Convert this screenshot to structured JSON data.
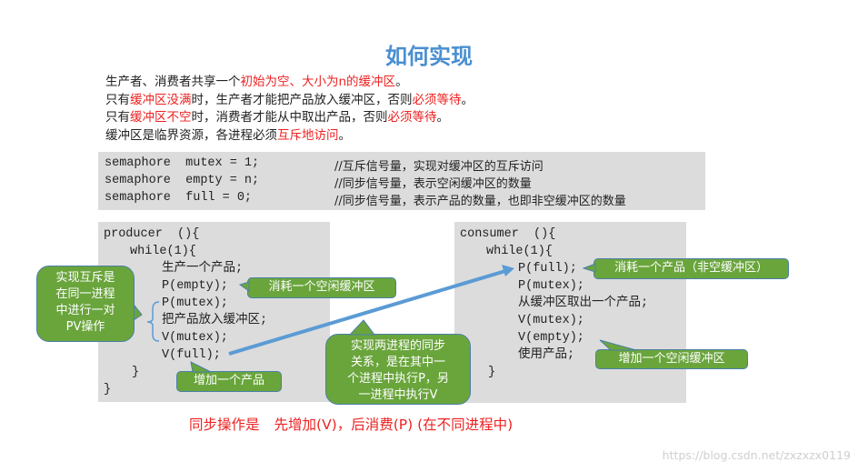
{
  "title": "如何实现",
  "intro": {
    "line1": {
      "a": "生产者、消费者共享一个",
      "b": "初始为空、大小为n的缓冲区",
      "c": "。"
    },
    "line2": {
      "a": "只有",
      "b": "缓冲区没满",
      "c": "时，生产者才能把产品放入缓冲区，否则",
      "d": "必须等待",
      "e": "。"
    },
    "line3": {
      "a": "只有",
      "b": "缓冲区不空",
      "c": "时，消费者才能从中取出产品，否则",
      "d": "必须等待",
      "e": "。"
    },
    "line4": {
      "a": "缓冲区是临界资源，各进程必须",
      "b": "互斥地访问",
      "c": "。"
    }
  },
  "semaphores": [
    {
      "decl": "semaphore  mutex = 1;",
      "comment": "//互斥信号量，实现对缓冲区的互斥访问"
    },
    {
      "decl": "semaphore  empty = n;",
      "comment": "//同步信号量，表示空闲缓冲区的数量"
    },
    {
      "decl": "semaphore  full = 0;",
      "comment": "//同步信号量，表示产品的数量，也即非空缓冲区的数量"
    }
  ],
  "producer": {
    "header": "producer  (){",
    "loop": "while(1){",
    "lines": [
      "生产一个产品;",
      "P(empty);",
      "P(mutex);",
      "把产品放入缓冲区;",
      "V(mutex);",
      "V(full);"
    ],
    "close_loop": "}",
    "close_fn": "}"
  },
  "consumer": {
    "header": "consumer  (){",
    "loop": "while(1){",
    "lines": [
      "P(full);",
      "P(mutex);",
      "从缓冲区取出一个产品;",
      "V(mutex);",
      "V(empty);",
      "使用产品;"
    ],
    "close_loop": "}"
  },
  "callouts": {
    "mutex_pair": "实现互斥是在同一进程中进行一对PV操作",
    "mutex_pair_lines": [
      "实现互斥是",
      "在同一进程",
      "中进行一对",
      "PV操作"
    ],
    "consume_empty": "消耗一个空闲缓冲区",
    "add_product": "增加一个产品",
    "sync_lines": [
      "实现两进程的同步",
      "关系，是在其中一",
      "个进程中执行P，另",
      "一进程中执行V"
    ],
    "consume_product": "消耗一个产品（非空缓冲区）",
    "add_empty": "增加一个空闲缓冲区"
  },
  "footer": {
    "a": "同步操作是",
    "b": "先增加(V)，后消费(P)  (在不同进程中)"
  },
  "watermark": "https://blog.csdn.net/zxzxzx0119",
  "colors": {
    "title": "#4a8fd0",
    "highlight": "#ee2222",
    "callout_fill": "#6aa53c",
    "callout_border": "#4b7fa8",
    "arrow": "#5b9bd5",
    "code_bg": "#dcdcdc"
  }
}
